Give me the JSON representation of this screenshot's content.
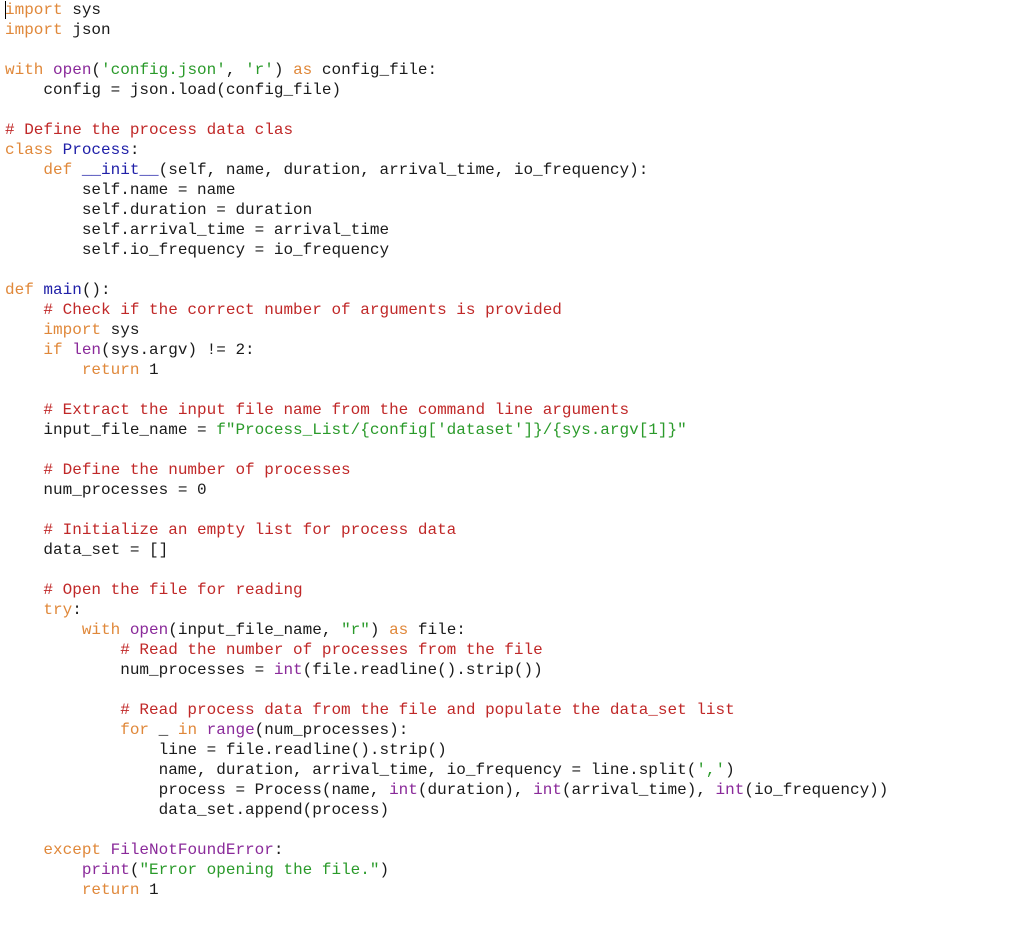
{
  "editor": {
    "language": "python",
    "colors": {
      "keyword": "#e0883a",
      "builtin": "#8a2a9a",
      "string": "#2a9a2a",
      "comment": "#c02828",
      "definition": "#2020a8",
      "text": "#1a1a1a",
      "background": "#ffffff"
    },
    "lines": [
      [
        [
          "kw",
          "import"
        ],
        [
          "tx",
          " sys"
        ]
      ],
      [
        [
          "kw",
          "import"
        ],
        [
          "tx",
          " json"
        ]
      ],
      [],
      [
        [
          "kw",
          "with"
        ],
        [
          "tx",
          " "
        ],
        [
          "bi",
          "open"
        ],
        [
          "tx",
          "("
        ],
        [
          "st",
          "'config.json'"
        ],
        [
          "tx",
          ", "
        ],
        [
          "st",
          "'r'"
        ],
        [
          "tx",
          ") "
        ],
        [
          "kw",
          "as"
        ],
        [
          "tx",
          " config_file:"
        ]
      ],
      [
        [
          "tx",
          "    config = json.load(config_file)"
        ]
      ],
      [],
      [
        [
          "cm",
          "# Define the process data clas"
        ]
      ],
      [
        [
          "kw",
          "class"
        ],
        [
          "tx",
          " "
        ],
        [
          "nm",
          "Process"
        ],
        [
          "tx",
          ":"
        ]
      ],
      [
        [
          "tx",
          "    "
        ],
        [
          "kw",
          "def"
        ],
        [
          "tx",
          " "
        ],
        [
          "nm",
          "__init__"
        ],
        [
          "tx",
          "(self, name, duration, arrival_time, io_frequency):"
        ]
      ],
      [
        [
          "tx",
          "        self.name = name"
        ]
      ],
      [
        [
          "tx",
          "        self.duration = duration"
        ]
      ],
      [
        [
          "tx",
          "        self.arrival_time = arrival_time"
        ]
      ],
      [
        [
          "tx",
          "        self.io_frequency = io_frequency"
        ]
      ],
      [],
      [
        [
          "kw",
          "def"
        ],
        [
          "tx",
          " "
        ],
        [
          "nm",
          "main"
        ],
        [
          "tx",
          "():"
        ]
      ],
      [
        [
          "tx",
          "    "
        ],
        [
          "cm",
          "# Check if the correct number of arguments is provided"
        ]
      ],
      [
        [
          "tx",
          "    "
        ],
        [
          "kw",
          "import"
        ],
        [
          "tx",
          " sys"
        ]
      ],
      [
        [
          "tx",
          "    "
        ],
        [
          "kw",
          "if"
        ],
        [
          "tx",
          " "
        ],
        [
          "bi",
          "len"
        ],
        [
          "tx",
          "(sys.argv) != 2:"
        ]
      ],
      [
        [
          "tx",
          "        "
        ],
        [
          "kw",
          "return"
        ],
        [
          "tx",
          " 1"
        ]
      ],
      [],
      [
        [
          "tx",
          "    "
        ],
        [
          "cm",
          "# Extract the input file name from the command line arguments"
        ]
      ],
      [
        [
          "tx",
          "    input_file_name = "
        ],
        [
          "st",
          "f\"Process_List/{config['dataset']}/{sys.argv[1]}\""
        ]
      ],
      [],
      [
        [
          "tx",
          "    "
        ],
        [
          "cm",
          "# Define the number of processes"
        ]
      ],
      [
        [
          "tx",
          "    num_processes = 0"
        ]
      ],
      [],
      [
        [
          "tx",
          "    "
        ],
        [
          "cm",
          "# Initialize an empty list for process data"
        ]
      ],
      [
        [
          "tx",
          "    data_set = []"
        ]
      ],
      [],
      [
        [
          "tx",
          "    "
        ],
        [
          "cm",
          "# Open the file for reading"
        ]
      ],
      [
        [
          "tx",
          "    "
        ],
        [
          "kw",
          "try"
        ],
        [
          "tx",
          ":"
        ]
      ],
      [
        [
          "tx",
          "        "
        ],
        [
          "kw",
          "with"
        ],
        [
          "tx",
          " "
        ],
        [
          "bi",
          "open"
        ],
        [
          "tx",
          "(input_file_name, "
        ],
        [
          "st",
          "\"r\""
        ],
        [
          "tx",
          ") "
        ],
        [
          "kw",
          "as"
        ],
        [
          "tx",
          " file:"
        ]
      ],
      [
        [
          "tx",
          "            "
        ],
        [
          "cm",
          "# Read the number of processes from the file"
        ]
      ],
      [
        [
          "tx",
          "            num_processes = "
        ],
        [
          "bi",
          "int"
        ],
        [
          "tx",
          "(file.readline().strip())"
        ]
      ],
      [],
      [
        [
          "tx",
          "            "
        ],
        [
          "cm",
          "# Read process data from the file and populate the data_set list"
        ]
      ],
      [
        [
          "tx",
          "            "
        ],
        [
          "kw",
          "for"
        ],
        [
          "tx",
          " _ "
        ],
        [
          "kw",
          "in"
        ],
        [
          "tx",
          " "
        ],
        [
          "bi",
          "range"
        ],
        [
          "tx",
          "(num_processes):"
        ]
      ],
      [
        [
          "tx",
          "                line = file.readline().strip()"
        ]
      ],
      [
        [
          "tx",
          "                name, duration, arrival_time, io_frequency = line.split("
        ],
        [
          "st",
          "','"
        ],
        [
          "tx",
          ")"
        ]
      ],
      [
        [
          "tx",
          "                process = Process(name, "
        ],
        [
          "bi",
          "int"
        ],
        [
          "tx",
          "(duration), "
        ],
        [
          "bi",
          "int"
        ],
        [
          "tx",
          "(arrival_time), "
        ],
        [
          "bi",
          "int"
        ],
        [
          "tx",
          "(io_frequency))"
        ]
      ],
      [
        [
          "tx",
          "                data_set.append(process)"
        ]
      ],
      [],
      [
        [
          "tx",
          "    "
        ],
        [
          "kw",
          "except"
        ],
        [
          "tx",
          " "
        ],
        [
          "bi",
          "FileNotFoundError"
        ],
        [
          "tx",
          ":"
        ]
      ],
      [
        [
          "tx",
          "        "
        ],
        [
          "bi",
          "print"
        ],
        [
          "tx",
          "("
        ],
        [
          "st",
          "\"Error opening the file.\""
        ],
        [
          "tx",
          ")"
        ]
      ],
      [
        [
          "tx",
          "        "
        ],
        [
          "kw",
          "return"
        ],
        [
          "tx",
          " 1"
        ]
      ]
    ]
  }
}
